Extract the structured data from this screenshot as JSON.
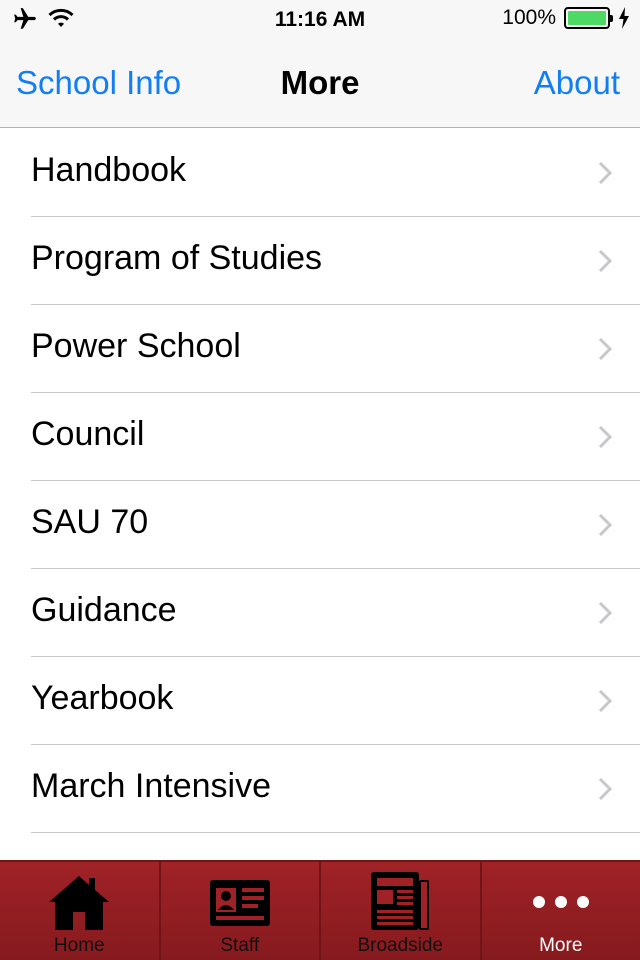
{
  "status_bar": {
    "time": "11:16 AM",
    "battery": "100%",
    "battery_level": 1.0
  },
  "nav": {
    "left": "School Info",
    "title": "More",
    "right": "About"
  },
  "list": {
    "items": [
      {
        "label": "Handbook"
      },
      {
        "label": "Program of Studies"
      },
      {
        "label": "Power School"
      },
      {
        "label": "Council"
      },
      {
        "label": "SAU 70"
      },
      {
        "label": "Guidance"
      },
      {
        "label": "Yearbook"
      },
      {
        "label": "March Intensive"
      }
    ]
  },
  "tabs": [
    {
      "label": "Home",
      "icon": "house-icon"
    },
    {
      "label": "Staff",
      "icon": "id-card-icon"
    },
    {
      "label": "Broadside",
      "icon": "newspaper-icon"
    },
    {
      "label": "More",
      "icon": "more-dots-icon",
      "active": true
    }
  ],
  "colors": {
    "accent": "#127ef6",
    "tab_bar": "#a02227",
    "battery": "#4cd964"
  }
}
